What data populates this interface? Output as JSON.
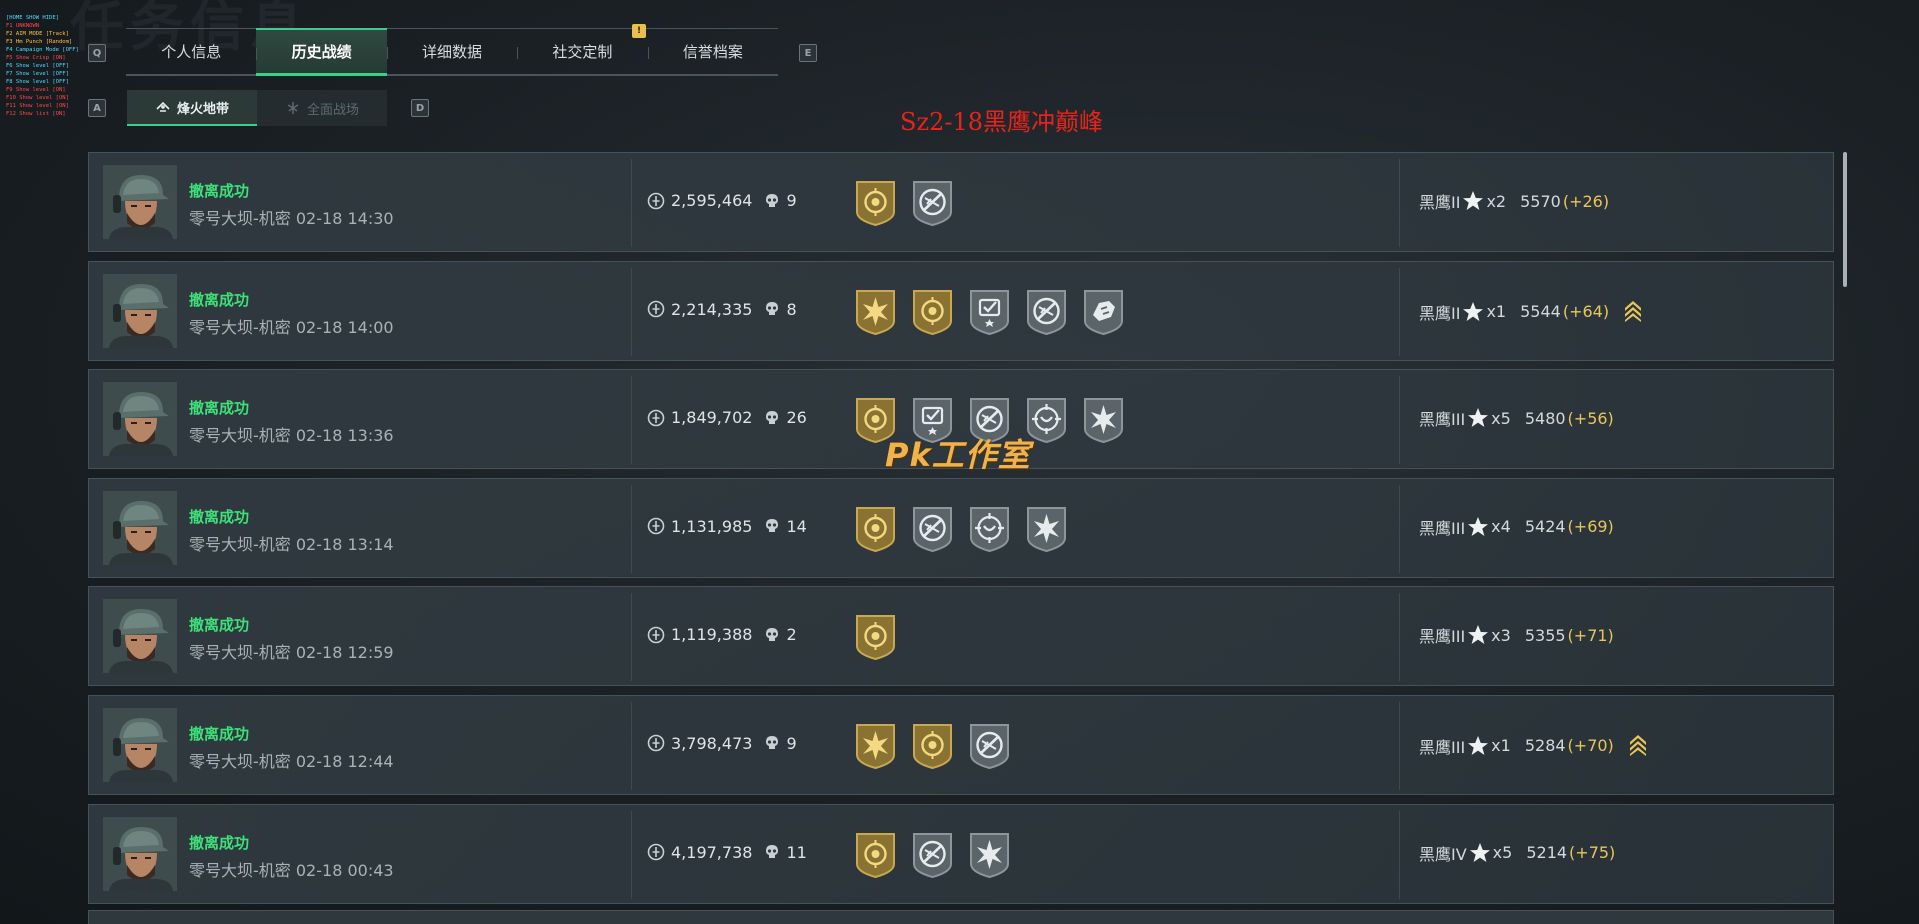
{
  "background_title": "任务信息",
  "debug_overlay": [
    {
      "text": "[HOME SHOW HIDE]",
      "color": "#58d8ff"
    },
    {
      "text": "F1 UNKNOWN",
      "color": "#ff4a4a"
    },
    {
      "text": "F2 AIM MODE [Track]",
      "color": "#ffc04a"
    },
    {
      "text": "F3 Hm Punch [Random]",
      "color": "#ffc04a"
    },
    {
      "text": "F4 Campaign Mode [OFF]",
      "color": "#58d8ff"
    },
    {
      "text": "F5 Show Crisp [ON]",
      "color": "#ff4a4a"
    },
    {
      "text": "F6 Show level [OFF]",
      "color": "#58d8ff"
    },
    {
      "text": "F7 Show level [OFF]",
      "color": "#58d8ff"
    },
    {
      "text": "F8 Show level [OFF]",
      "color": "#58d8ff"
    },
    {
      "text": "F9 Show level [ON]",
      "color": "#ff4a4a"
    },
    {
      "text": "F10 Show level [ON]",
      "color": "#ff4a4a"
    },
    {
      "text": "F11 Show level [ON]",
      "color": "#ff4a4a"
    },
    {
      "text": "F12 Show list [ON]",
      "color": "#ff4a4a"
    }
  ],
  "keys": {
    "prev_tab": "Q",
    "next_tab": "E",
    "prev_mode": "A",
    "next_mode": "D"
  },
  "tabs": [
    {
      "label": "个人信息",
      "active": false
    },
    {
      "label": "历史战绩",
      "active": true
    },
    {
      "label": "详细数据",
      "active": false
    },
    {
      "label": "社交定制",
      "active": false
    },
    {
      "label": "信誉档案",
      "active": false
    }
  ],
  "tab_badge": "!",
  "modes": [
    {
      "label": "烽火地带",
      "active": true,
      "icon": "fire-zone-icon"
    },
    {
      "label": "全面战场",
      "active": false,
      "icon": "full-battlefield-icon"
    }
  ],
  "overlay_title": "Sz2-18黑鹰冲巅峰",
  "watermark": "Pk工作室",
  "colors": {
    "accent_green": "#38d08a",
    "status_green": "#3ee07a",
    "delta_gold": "#e8c65a",
    "title_red": "#e8231c"
  },
  "matches": [
    {
      "status": "撤离成功",
      "map": "零号大坝-机密",
      "time": "02-18 14:30",
      "value": "2,595,464",
      "kills": "9",
      "badges": [
        "gold-shield",
        "silver-no-gun"
      ],
      "rank": "黑鹰II",
      "stars": "x2",
      "score": "5570",
      "delta": "(+26)",
      "promote": false
    },
    {
      "status": "撤离成功",
      "map": "零号大坝-机密",
      "time": "02-18 14:00",
      "value": "2,214,335",
      "kills": "8",
      "badges": [
        "gold-burst",
        "gold-shield",
        "silver-check",
        "silver-no-gun",
        "silver-hand"
      ],
      "rank": "黑鹰II",
      "stars": "x1",
      "score": "5544",
      "delta": "(+64)",
      "promote": true
    },
    {
      "status": "撤离成功",
      "map": "零号大坝-机密",
      "time": "02-18 13:36",
      "value": "1,849,702",
      "kills": "26",
      "badges": [
        "gold-shield",
        "silver-check",
        "silver-no-gun",
        "silver-target",
        "silver-burst"
      ],
      "rank": "黑鹰III",
      "stars": "x5",
      "score": "5480",
      "delta": "(+56)",
      "promote": false
    },
    {
      "status": "撤离成功",
      "map": "零号大坝-机密",
      "time": "02-18 13:14",
      "value": "1,131,985",
      "kills": "14",
      "badges": [
        "gold-shield",
        "silver-no-gun",
        "silver-target",
        "silver-burst"
      ],
      "rank": "黑鹰III",
      "stars": "x4",
      "score": "5424",
      "delta": "(+69)",
      "promote": false
    },
    {
      "status": "撤离成功",
      "map": "零号大坝-机密",
      "time": "02-18 12:59",
      "value": "1,119,388",
      "kills": "2",
      "badges": [
        "gold-shield"
      ],
      "rank": "黑鹰III",
      "stars": "x3",
      "score": "5355",
      "delta": "(+71)",
      "promote": false
    },
    {
      "status": "撤离成功",
      "map": "零号大坝-机密",
      "time": "02-18 12:44",
      "value": "3,798,473",
      "kills": "9",
      "badges": [
        "gold-burst",
        "gold-shield",
        "silver-no-gun"
      ],
      "rank": "黑鹰III",
      "stars": "x1",
      "score": "5284",
      "delta": "(+70)",
      "promote": true
    },
    {
      "status": "撤离成功",
      "map": "零号大坝-机密",
      "time": "02-18 00:43",
      "value": "4,197,738",
      "kills": "11",
      "badges": [
        "gold-shield",
        "silver-no-gun",
        "silver-burst"
      ],
      "rank": "黑鹰IV",
      "stars": "x5",
      "score": "5214",
      "delta": "(+75)",
      "promote": false
    }
  ]
}
